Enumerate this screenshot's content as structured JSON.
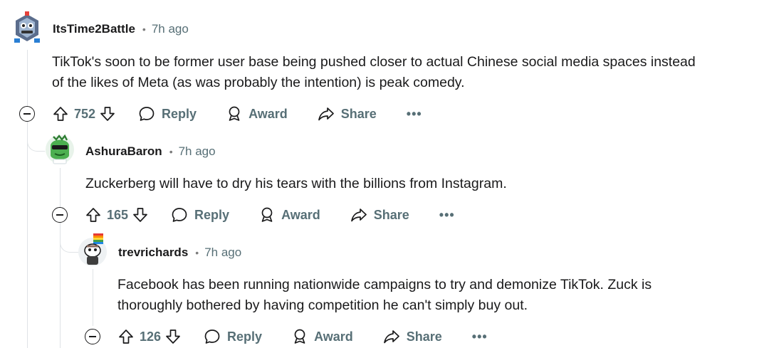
{
  "comments": [
    {
      "username": "ItsTime2Battle",
      "time": "7h ago",
      "body_lines": [
        "TikTok's soon to be former user base being pushed closer to actual Chinese social media spaces instead",
        "of the likes of Meta (as was probably the intention) is peak comedy."
      ],
      "votes": "752"
    },
    {
      "username": "AshuraBaron",
      "time": "7h ago",
      "body_lines": [
        "Zuckerberg will have to dry his tears with the billions from Instagram."
      ],
      "votes": "165"
    },
    {
      "username": "trevrichards",
      "time": "7h ago",
      "body_lines": [
        "Facebook has been running nationwide campaigns to try and demonize TikTok. Zuck is",
        "thoroughly bothered by having competition he can't simply buy out."
      ],
      "votes": "126"
    }
  ],
  "actions": {
    "reply": "Reply",
    "award": "Award",
    "share": "Share",
    "more": "•••"
  },
  "colors": {
    "text": "#1a1a1b",
    "meta": "#576f76",
    "thread_line": "#dfe3e6"
  }
}
